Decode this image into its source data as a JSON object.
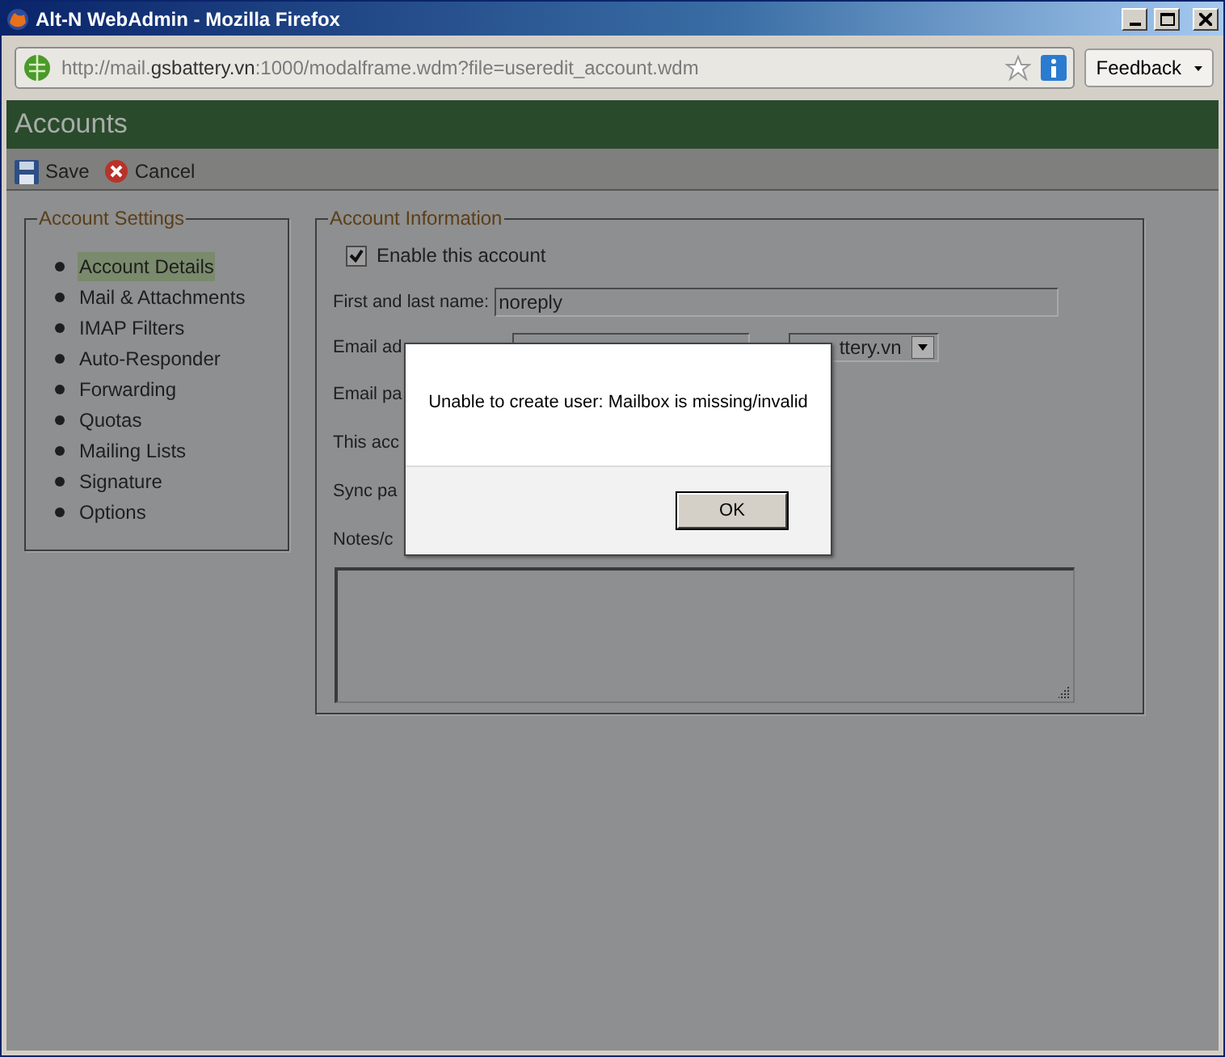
{
  "window": {
    "title": "Alt-N WebAdmin - Mozilla Firefox"
  },
  "address_bar": {
    "url": [
      {
        "text": "http://mail.",
        "highlight": false
      },
      {
        "text": "gsbattery.vn",
        "highlight": true
      },
      {
        "text": ":1000/modalframe.wdm?file=useredit_account.wdm",
        "highlight": false
      }
    ]
  },
  "feedback_button": "Feedback",
  "page_header": {
    "title": "Accounts"
  },
  "toolbar": [
    {
      "label": "Save",
      "kind": "save"
    },
    {
      "label": "Cancel",
      "kind": "cancel"
    }
  ],
  "account_settings": {
    "legend": "Account Settings",
    "items": [
      {
        "label": "Account Details",
        "selected": true
      },
      {
        "label": "Mail & Attachments",
        "selected": false
      },
      {
        "label": "IMAP Filters",
        "selected": false
      },
      {
        "label": "Auto-Responder",
        "selected": false
      },
      {
        "label": "Forwarding",
        "selected": false
      },
      {
        "label": "Quotas",
        "selected": false
      },
      {
        "label": "Mailing Lists",
        "selected": false
      },
      {
        "label": "Signature",
        "selected": false
      },
      {
        "label": "Options",
        "selected": false
      }
    ]
  },
  "account_information": {
    "legend": "Account Information",
    "enable_account": {
      "label": "Enable this account",
      "checked": true
    },
    "fields": [
      {
        "kind": "text",
        "label": "First and last name:",
        "value": "noreply"
      },
      {
        "kind": "email",
        "label": "Email ad",
        "domain": "ttery.vn"
      },
      {
        "kind": "label",
        "label": "Email pa"
      },
      {
        "kind": "label",
        "label": "This acc"
      },
      {
        "kind": "label",
        "label": "Sync pa"
      },
      {
        "kind": "notes",
        "label": "Notes/c"
      }
    ]
  },
  "dialog": {
    "message": "Unable to create user: Mailbox is missing/invalid",
    "button": "OK"
  }
}
